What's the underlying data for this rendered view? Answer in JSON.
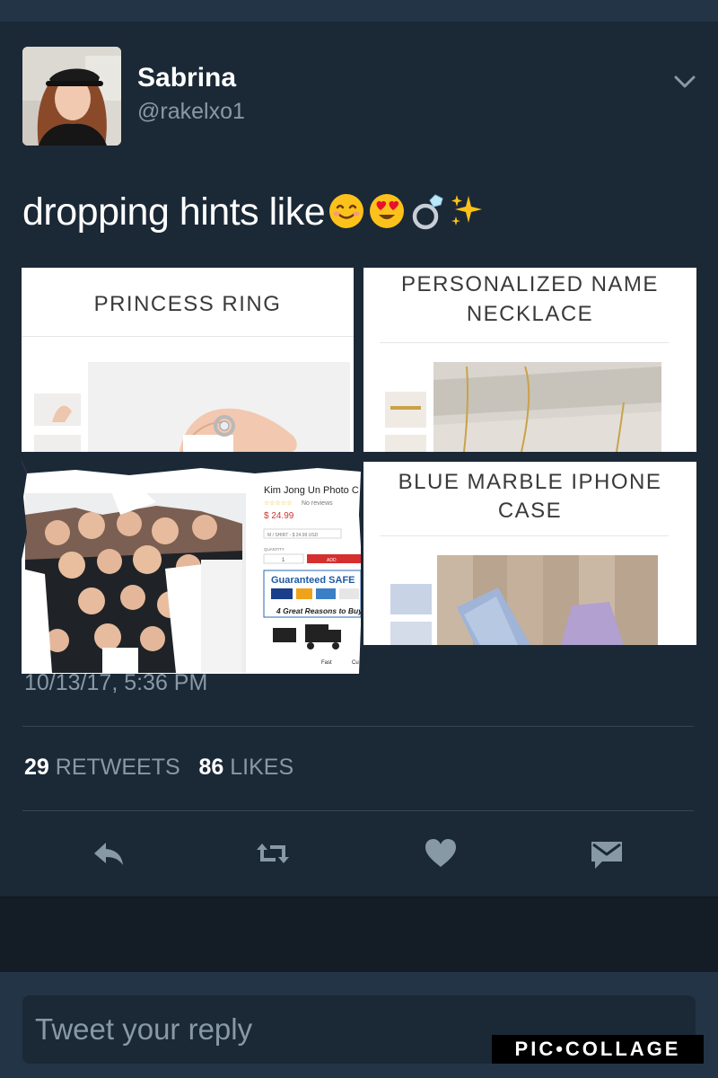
{
  "user": {
    "name": "Sabrina",
    "handle": "@rakelxo1"
  },
  "tweet": {
    "text": "dropping hints like",
    "emoji": [
      "smiling-face-icon",
      "heart-eyes-icon",
      "ring-icon",
      "sparkles-icon"
    ],
    "timestamp": "10/13/17, 5:36 PM"
  },
  "collage": {
    "tile1": {
      "title": "PRINCESS RING"
    },
    "tile2": {
      "title_line1": "PERSONALIZED NAME",
      "title_line2": "NECKLACE"
    },
    "tile3": {
      "product": "Kim Jong Un Photo C",
      "reviews": "No reviews",
      "price": "$ 24.99",
      "select": "M / SHIRT - $ 24.99 USD",
      "qty_label": "QUANTITY",
      "qty_value": "1",
      "add": "ADD",
      "safe": "Guaranteed SAFE",
      "reasons": "4 Great Reasons to Buy",
      "fast": "Fast",
      "cu": "Cu"
    },
    "tile4": {
      "title_line1": "BLUE MARBLE IPHONE",
      "title_line2": "CASE"
    }
  },
  "stats": {
    "retweets_count": "29",
    "retweets_label": "RETWEETS",
    "likes_count": "86",
    "likes_label": "LIKES"
  },
  "reply": {
    "placeholder": "Tweet your reply"
  },
  "watermark": "PIC•COLLAGE",
  "colors": {
    "background": "#1b2836",
    "secondary_text": "#8899a6",
    "divider": "#38444d"
  }
}
